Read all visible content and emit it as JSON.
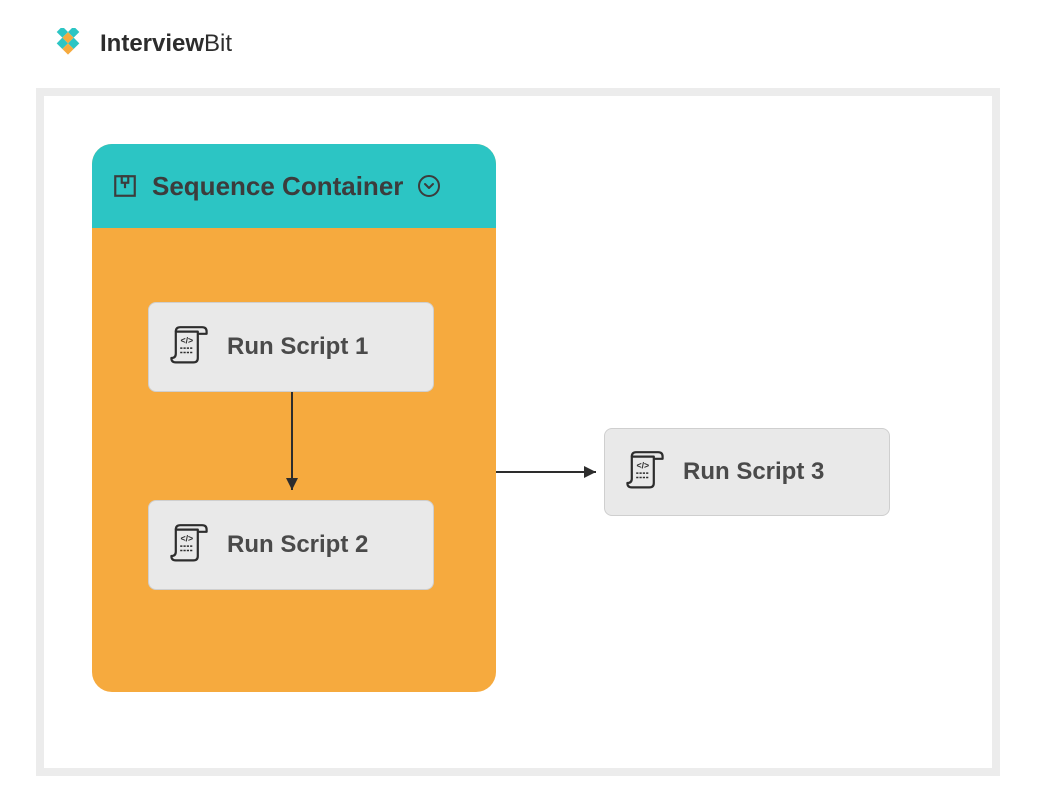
{
  "brand": {
    "name_bold": "Interview",
    "name_light": "Bit"
  },
  "diagram": {
    "container_title": "Sequence Container",
    "tasks": {
      "t1": "Run Script 1",
      "t2": "Run Script 2",
      "t3": "Run Script 3"
    }
  }
}
